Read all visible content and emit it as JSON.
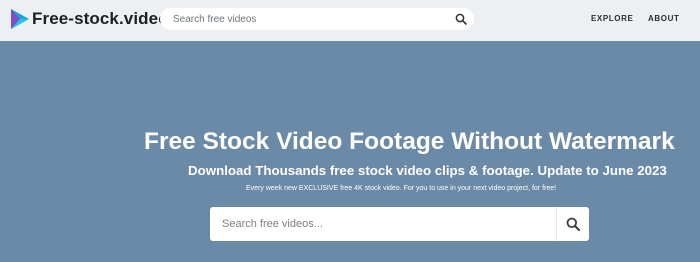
{
  "header": {
    "logo_text": "Free-stock.video",
    "search_placeholder": "Search free videos",
    "nav": [
      {
        "label": "EXPLORE"
      },
      {
        "label": "ABOUT"
      }
    ]
  },
  "hero": {
    "title": "Free Stock Video Footage Without Watermark",
    "subtitle": "Download Thousands free stock video clips & footage. Update to June 2023",
    "note": "Every week new EXCLUSIVE free 4K stock video. For you to use in your next video project, for free!",
    "search_placeholder": "Search free videos..."
  },
  "colors": {
    "header_bg": "#edf0f2",
    "hero_bg": "#6b8aa8",
    "logo_blue": "#1ba3d6",
    "logo_purple": "#7a4fc9"
  }
}
